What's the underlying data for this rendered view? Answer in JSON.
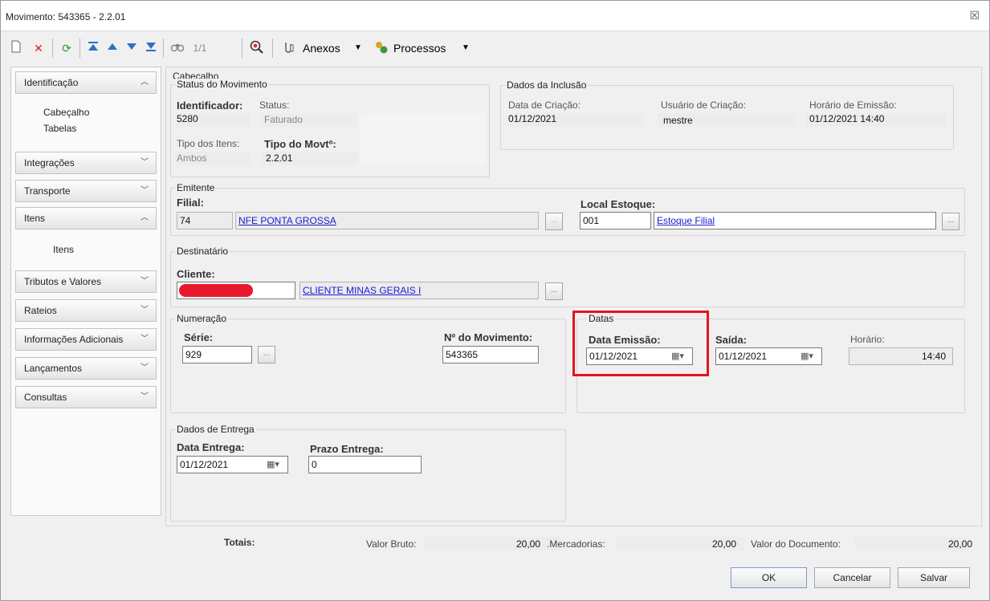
{
  "window": {
    "title": "Movimento: 543365 - 2.2.01",
    "close_glyph": "☒"
  },
  "toolbar": {
    "icons": [
      "new-icon",
      "delete-icon",
      "refresh-icon",
      "first-icon",
      "prev-icon",
      "next-icon",
      "last-icon",
      "find-icon",
      "zoom-icon",
      "attach-icon",
      "process-icon"
    ],
    "record_counter": "1/1",
    "anexos_label": "Anexos",
    "processos_label": "Processos"
  },
  "sidebar": {
    "sections": [
      {
        "label": "Identificação",
        "expanded": true,
        "items": [
          "Cabeçalho",
          "Tabelas"
        ]
      },
      {
        "label": "Integrações",
        "expanded": false
      },
      {
        "label": "Transporte",
        "expanded": false
      },
      {
        "label": "Itens",
        "expanded": true,
        "items": [
          "Itens"
        ]
      },
      {
        "label": "Tributos e Valores",
        "expanded": false
      },
      {
        "label": "Rateios",
        "expanded": false
      },
      {
        "label": "Informações Adicionais",
        "expanded": false
      },
      {
        "label": "Lançamentos",
        "expanded": false
      },
      {
        "label": "Consultas",
        "expanded": false
      }
    ]
  },
  "main": {
    "section_title": "Cabeçalho",
    "status": {
      "title": "Status do Movimento",
      "identificador_label": "Identificador:",
      "identificador_value": "5280",
      "status_label": "Status:",
      "status_value": "Faturado",
      "tipo_itens_label": "Tipo dos Itens:",
      "tipo_itens_value": "Ambos",
      "tipo_movto_label": "Tipo do Movtº:",
      "tipo_movto_value": "2.2.01"
    },
    "inclusao": {
      "title": "Dados da Inclusão",
      "data_criacao_label": "Data de Criação:",
      "data_criacao_value": "01/12/2021",
      "usuario_label": "Usuário de Criação:",
      "usuario_value": "mestre",
      "horario_label": "Horário de Emissão:",
      "horario_value": "01/12/2021 14:40"
    },
    "emitente": {
      "title": "Emitente",
      "filial_label": "Filial:",
      "filial_code": "74",
      "filial_name": "NFE PONTA GROSSA",
      "local_label": "Local Estoque:",
      "local_code": "001",
      "local_name": "Estoque Filial"
    },
    "destinatario": {
      "title": "Destinatário",
      "cliente_label": "Cliente:",
      "cliente_name": "CLIENTE MINAS GERAIS I"
    },
    "numeracao": {
      "title": "Numeração",
      "serie_label": "Série:",
      "serie_value": "929",
      "numero_label": "Nº do Movimento:",
      "numero_value": "543365"
    },
    "datas": {
      "title": "Datas",
      "emissao_label": "Data Emissão:",
      "emissao_value": "01/12/2021",
      "saida_label": "Saída:",
      "saida_value": "01/12/2021",
      "horario_label": "Horário:",
      "horario_value": "14:40"
    },
    "entrega": {
      "title": "Dados de Entrega",
      "data_label": "Data Entrega:",
      "data_value": "01/12/2021",
      "prazo_label": "Prazo Entrega:",
      "prazo_value": "0"
    }
  },
  "totals": {
    "label": "Totais:",
    "valor_bruto_label": "Valor Bruto:",
    "valor_bruto_value": "20,00",
    "mercadorias_label": ".Mercadorias:",
    "mercadorias_value": "20,00",
    "documento_label": "Valor do Documento:",
    "documento_value": "20,00"
  },
  "buttons": {
    "ok": "OK",
    "cancel": "Cancelar",
    "save": "Salvar"
  },
  "colors": {
    "highlight": "#e3141f",
    "link": "#1a1ad8",
    "redaction": "#e8192c"
  }
}
